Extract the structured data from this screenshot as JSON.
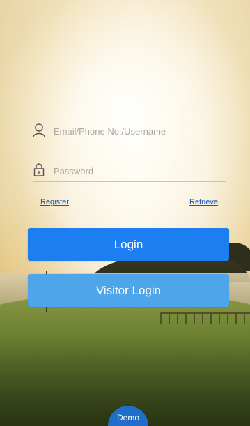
{
  "login_form": {
    "username": {
      "icon": "user-icon",
      "placeholder": "Email/Phone No./Username",
      "value": ""
    },
    "password": {
      "icon": "lock-icon",
      "placeholder": "Password",
      "value": ""
    },
    "register_link": "Register",
    "retrieve_link": "Retrieve",
    "login_button": "Login",
    "visitor_login_button": "Visitor Login"
  },
  "demo_button": "Demo",
  "colors": {
    "login_button": "#1c7ef0",
    "visitor_button": "#4ea5ea",
    "demo_button": "#1f6fc8",
    "link": "#1f56b8"
  }
}
